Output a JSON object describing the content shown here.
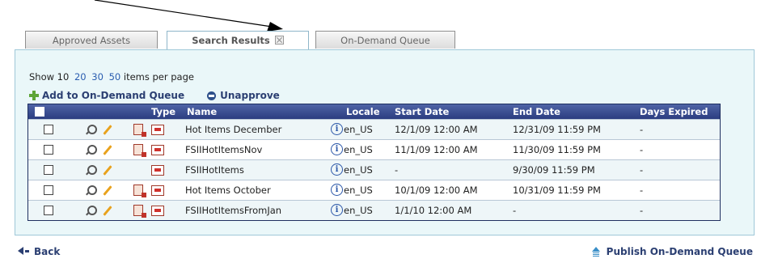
{
  "tabs": [
    {
      "label": "Approved Assets"
    },
    {
      "label": "Search Results"
    },
    {
      "label": "On-Demand Queue"
    }
  ],
  "per_page": {
    "prefix": "Show 10",
    "options": [
      "20",
      "30",
      "50"
    ],
    "suffix": "items per page"
  },
  "actions": {
    "add_label": "Add to On-Demand Queue",
    "unapprove_label": "Unapprove"
  },
  "table": {
    "headers": {
      "type": "Type",
      "name": "Name",
      "locale": "Locale",
      "start_date": "Start Date",
      "end_date": "End Date",
      "days_expired": "Days Expired"
    },
    "rows": [
      {
        "name": "Hot Items December",
        "locale": "en_US",
        "start": "12/1/09 12:00 AM",
        "end": "12/31/09 11:59 PM",
        "days": "-"
      },
      {
        "name": "FSIIHotItemsNov",
        "locale": "en_US",
        "start": "11/1/09 12:00 AM",
        "end": "11/30/09 11:59 PM",
        "days": "-"
      },
      {
        "name": "FSIIHotItems",
        "locale": "en_US",
        "start": "-",
        "end": "9/30/09 11:59 PM",
        "days": "-"
      },
      {
        "name": "Hot Items October",
        "locale": "en_US",
        "start": "10/1/09 12:00 AM",
        "end": "10/31/09 11:59 PM",
        "days": "-"
      },
      {
        "name": "FSIIHotItemsFromJan",
        "locale": "en_US",
        "start": "1/1/10 12:00 AM",
        "end": "-",
        "days": "-"
      }
    ]
  },
  "footer": {
    "back_label": "Back",
    "publish_label": "Publish On-Demand Queue"
  }
}
